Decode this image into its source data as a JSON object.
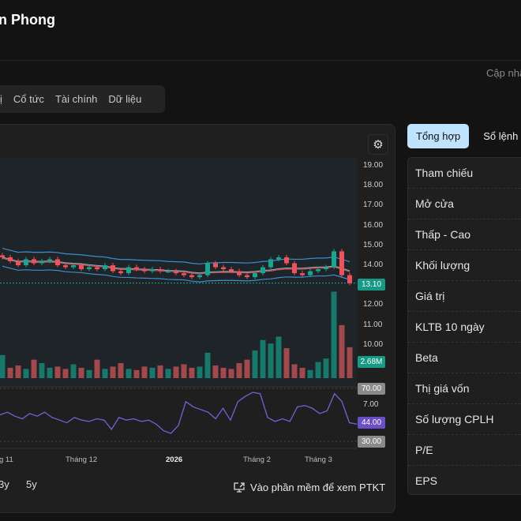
{
  "header": {
    "title": "n Phong",
    "updated_label": "Cập nhậ"
  },
  "tabs": [
    "ị",
    "Cổ tức",
    "Tài chính",
    "Dữ liệu"
  ],
  "chart": {
    "settings_icon": "gear-icon",
    "ranges": [
      "3y",
      "5y"
    ],
    "open_app_label": "Vào phần mềm để xem PTKT",
    "open_app_icon": "monitor-external-icon"
  },
  "chart_data": {
    "type": "candlestick",
    "price_axis": [
      "19.00",
      "18.00",
      "17.00",
      "16.00",
      "15.00",
      "14.00",
      "12.00",
      "11.00",
      "10.00"
    ],
    "price_ylim": [
      9.5,
      19.4
    ],
    "last_price_tag": "13.10",
    "last_volume_tag": "2.68M",
    "x_labels": [
      "g 11",
      "Tháng 12",
      "2026",
      "Tháng 2",
      "Tháng 3"
    ],
    "closes": [
      14.4,
      14.2,
      14.0,
      14.3,
      14.1,
      14.2,
      14.3,
      14.0,
      13.9,
      14.0,
      13.8,
      13.9,
      13.8,
      14.0,
      13.7,
      13.6,
      13.9,
      13.8,
      13.7,
      13.8,
      13.7,
      13.7,
      13.6,
      13.5,
      13.4,
      13.5,
      14.1,
      13.9,
      13.8,
      13.7,
      13.5,
      13.4,
      13.6,
      13.9,
      14.3,
      14.4,
      14.1,
      13.6,
      13.5,
      13.7,
      13.8,
      13.9,
      14.7,
      13.5,
      13.1
    ],
    "volumes_m": [
      2.0,
      0.9,
      1.1,
      0.8,
      1.6,
      1.3,
      0.9,
      1.0,
      0.8,
      1.2,
      0.9,
      0.7,
      1.6,
      0.8,
      1.0,
      1.3,
      0.8,
      0.7,
      1.0,
      0.9,
      1.1,
      0.8,
      1.0,
      1.2,
      0.9,
      1.0,
      2.2,
      1.1,
      0.9,
      0.8,
      1.3,
      1.6,
      2.4,
      3.3,
      3.0,
      3.6,
      2.6,
      1.2,
      0.9,
      0.7,
      1.4,
      1.7,
      7.5,
      4.6,
      2.68
    ],
    "rsi": {
      "levels": [
        "70.00",
        "30.00"
      ],
      "axis_label": "7.00",
      "last_tag": "44.00",
      "values": [
        50,
        52,
        49,
        47,
        51,
        49,
        52,
        48,
        46,
        44,
        48,
        46,
        45,
        47,
        46,
        39,
        48,
        46,
        47,
        45,
        46,
        43,
        38,
        36,
        42,
        60,
        56,
        54,
        52,
        47,
        55,
        46,
        60,
        64,
        67,
        66,
        48,
        45,
        47,
        45,
        56,
        57,
        55,
        51,
        53,
        66,
        60,
        44,
        43
      ]
    },
    "colors": {
      "up": "#1aa58f",
      "down": "#f0525a",
      "bollinger": "#3a8ed0",
      "rsi": "#7b5ed6",
      "ma": "#d0504f"
    }
  },
  "side": {
    "tabs": [
      "Tổng hợp",
      "Sổ lệnh"
    ],
    "rows": [
      "Tham chiếu",
      "Mở cửa",
      "Thấp - Cao",
      "Khối lượng",
      "Giá trị",
      "KLTB 10 ngày",
      "Beta",
      "Thị giá vốn",
      "Số lượng CPLH",
      "P/E",
      "EPS"
    ]
  }
}
